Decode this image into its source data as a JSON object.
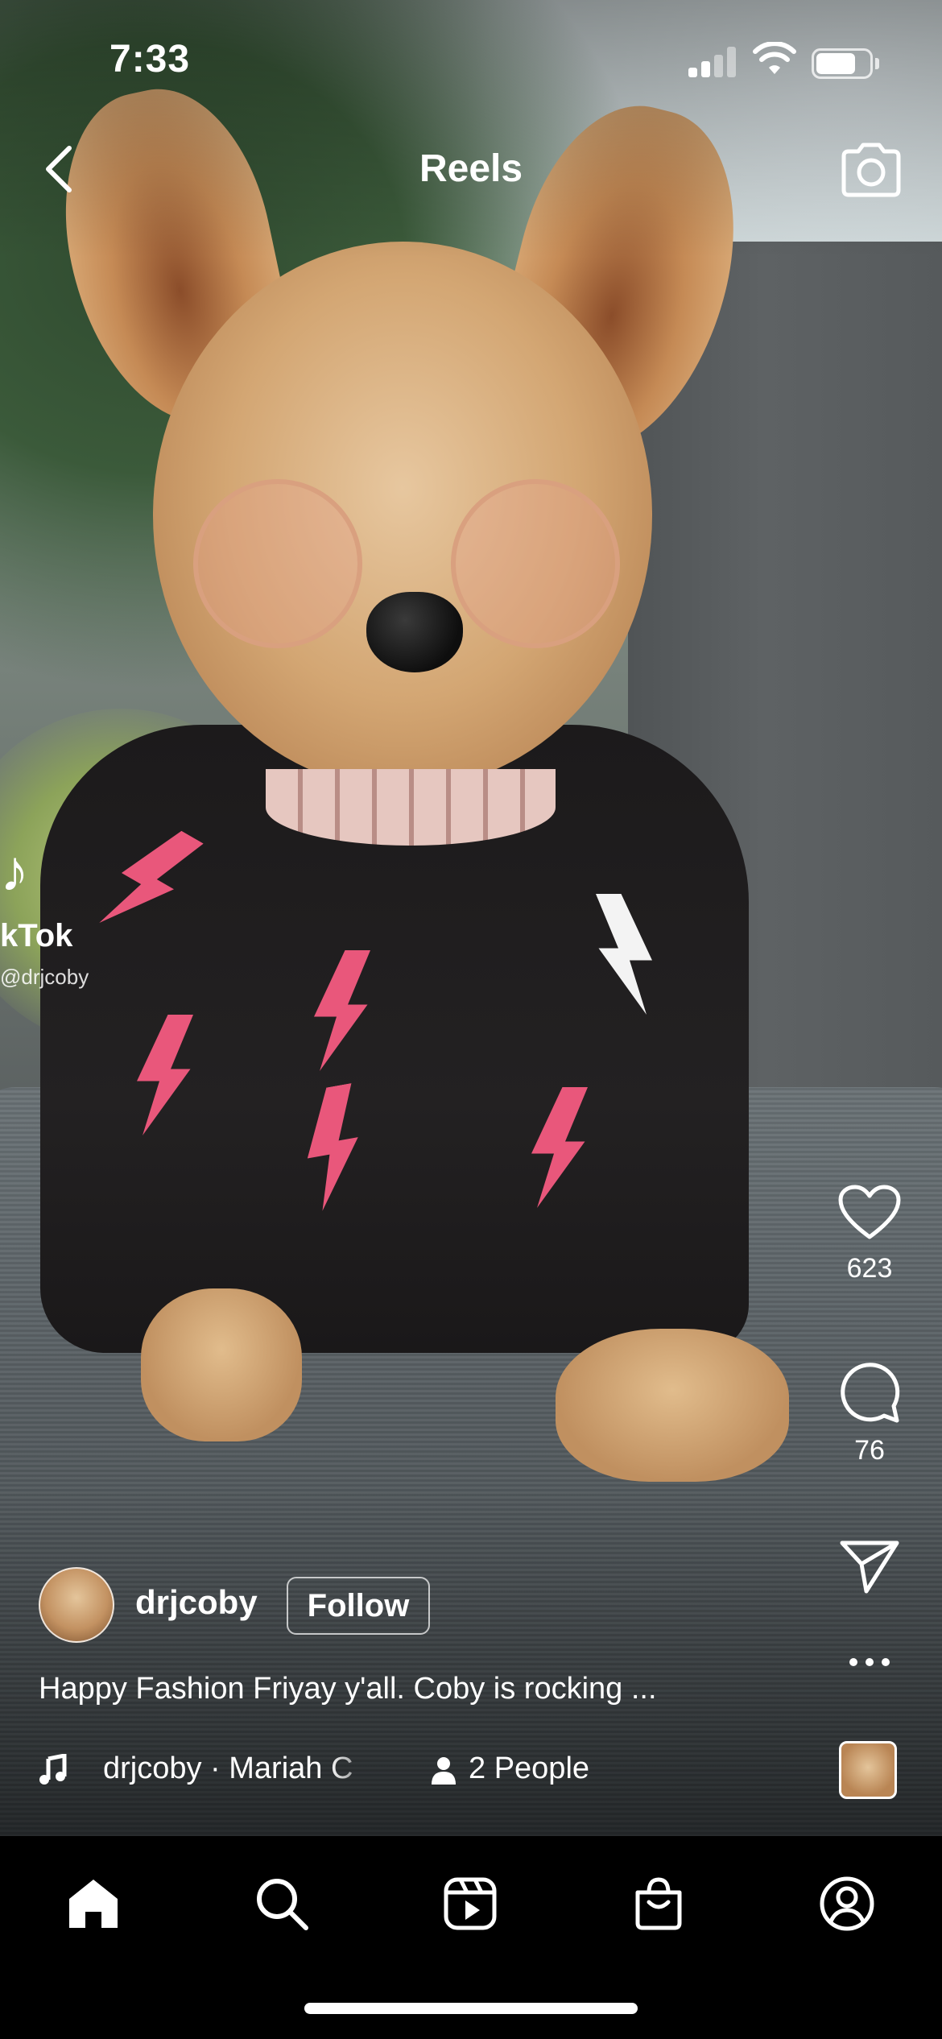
{
  "status_bar": {
    "time": "7:33"
  },
  "header": {
    "title": "Reels"
  },
  "watermark": {
    "name": "kTok",
    "handle": "@drjcoby"
  },
  "actions": {
    "likes": "623",
    "comments": "76"
  },
  "post": {
    "username": "drjcoby",
    "follow_label": "Follow",
    "caption": "Happy Fashion Friyay y'all. Coby is rocking ...",
    "audio": "drjcoby · Mariah C",
    "people": "2 People"
  },
  "tabs": [
    "home",
    "search",
    "reels",
    "shop",
    "profile"
  ],
  "colors": {
    "accent_bolt": "#e9577b",
    "tab_bar": "#000000"
  }
}
